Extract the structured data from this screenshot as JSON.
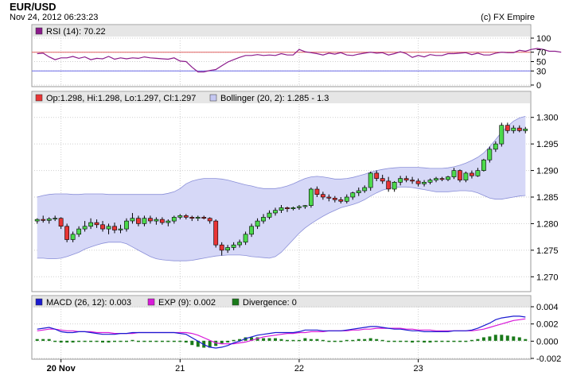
{
  "header": {
    "title": "EUR/USD",
    "date": "Nov 24, 2012 06:23:23",
    "copyright": "(c) FX Empire"
  },
  "colors": {
    "bull": "#4cd94c",
    "bear": "#e83535",
    "band": "#d6d8f7",
    "bandLine": "#8a8fd8",
    "rsi": "#8b1a8b",
    "rsiOver": "#e06060",
    "rsiUnder": "#6a6ae8",
    "macd": "#1a1ad0",
    "exp": "#d91ad9",
    "div": "#1a7a1a",
    "panelHeader": "#e6e6e6",
    "grid": "#cfcfcf",
    "border": "#9a9a9a"
  },
  "chart_data": [
    {
      "type": "line",
      "title": "RSI (14): 70.22",
      "ylim": [
        0,
        100
      ],
      "yticks": [
        "100",
        "70",
        "50",
        "30",
        "0"
      ],
      "levels": {
        "over": 70,
        "under": 30
      },
      "values": [
        67,
        68,
        60,
        54,
        58,
        58,
        61,
        57,
        60,
        54,
        57,
        56,
        61,
        55,
        58,
        56,
        58,
        57,
        60,
        58,
        57,
        56,
        55,
        58,
        51,
        50,
        38,
        28,
        28,
        31,
        33,
        41,
        49,
        54,
        59,
        63,
        63,
        65,
        63,
        64,
        63,
        67,
        64,
        64,
        76,
        71,
        69,
        67,
        64,
        68,
        66,
        69,
        64,
        63,
        66,
        68,
        70,
        68,
        69,
        64,
        67,
        71,
        67,
        59,
        63,
        60,
        65,
        63,
        63,
        67,
        67,
        68,
        69,
        65,
        68,
        64,
        64,
        68,
        70,
        69,
        69,
        74,
        72,
        76,
        78,
        76,
        72,
        72,
        70
      ]
    },
    {
      "type": "candlestick",
      "legend": [
        "Op:1.298, Hi:1.298, Lo:1.297, Cl:1.297",
        "Bollinger (20, 2): 1.285 - 1.3"
      ],
      "ylim": [
        1.2675,
        1.3025
      ],
      "yticks": [
        "1.300",
        "1.295",
        "1.290",
        "1.285",
        "1.280",
        "1.275",
        "1.270"
      ],
      "candles": [
        [
          1.2805,
          1.281,
          1.28,
          1.2808
        ],
        [
          1.2808,
          1.2815,
          1.2802,
          1.2806
        ],
        [
          1.2806,
          1.2812,
          1.28,
          1.2809
        ],
        [
          1.2809,
          1.2815,
          1.2805,
          1.281
        ],
        [
          1.281,
          1.2812,
          1.279,
          1.2795
        ],
        [
          1.2795,
          1.28,
          1.2765,
          1.277
        ],
        [
          1.277,
          1.2785,
          1.2765,
          1.278
        ],
        [
          1.278,
          1.2795,
          1.2775,
          1.279
        ],
        [
          1.279,
          1.2805,
          1.2785,
          1.2795
        ],
        [
          1.2795,
          1.281,
          1.279,
          1.2802
        ],
        [
          1.2802,
          1.2808,
          1.2792,
          1.2798
        ],
        [
          1.2798,
          1.2805,
          1.2785,
          1.279
        ],
        [
          1.279,
          1.28,
          1.278,
          1.2795
        ],
        [
          1.2795,
          1.2802,
          1.2782,
          1.2788
        ],
        [
          1.2788,
          1.2798,
          1.2782,
          1.279
        ],
        [
          1.279,
          1.281,
          1.2785,
          1.2805
        ],
        [
          1.2805,
          1.282,
          1.28,
          1.281
        ],
        [
          1.281,
          1.2815,
          1.2795,
          1.28
        ],
        [
          1.28,
          1.2815,
          1.2795,
          1.281
        ],
        [
          1.281,
          1.2815,
          1.28,
          1.2805
        ],
        [
          1.2805,
          1.2812,
          1.2798,
          1.2808
        ],
        [
          1.2808,
          1.2812,
          1.2798,
          1.2802
        ],
        [
          1.2802,
          1.2808,
          1.2795,
          1.2805
        ],
        [
          1.2805,
          1.2815,
          1.28,
          1.2812
        ],
        [
          1.2812,
          1.2818,
          1.2808,
          1.2815
        ],
        [
          1.2815,
          1.2818,
          1.2808,
          1.2812
        ],
        [
          1.2812,
          1.2815,
          1.2805,
          1.281
        ],
        [
          1.281,
          1.2815,
          1.2805,
          1.2812
        ],
        [
          1.2812,
          1.2815,
          1.2808,
          1.281
        ],
        [
          1.281,
          1.2812,
          1.28,
          1.2805
        ],
        [
          1.2805,
          1.2808,
          1.2755,
          1.276
        ],
        [
          1.276,
          1.2765,
          1.274,
          1.275
        ],
        [
          1.275,
          1.276,
          1.2745,
          1.2755
        ],
        [
          1.2755,
          1.2765,
          1.275,
          1.276
        ],
        [
          1.276,
          1.277,
          1.2755,
          1.2765
        ],
        [
          1.2765,
          1.2785,
          1.276,
          1.278
        ],
        [
          1.278,
          1.28,
          1.2775,
          1.2795
        ],
        [
          1.2795,
          1.281,
          1.279,
          1.2805
        ],
        [
          1.2805,
          1.2818,
          1.28,
          1.2812
        ],
        [
          1.2812,
          1.2825,
          1.2808,
          1.282
        ],
        [
          1.282,
          1.283,
          1.2815,
          1.2825
        ],
        [
          1.2825,
          1.2835,
          1.282,
          1.283
        ],
        [
          1.283,
          1.2832,
          1.2822,
          1.2828
        ],
        [
          1.2828,
          1.2832,
          1.2825,
          1.283
        ],
        [
          1.283,
          1.2835,
          1.2826,
          1.2832
        ],
        [
          1.2832,
          1.2835,
          1.2828,
          1.2834
        ],
        [
          1.2834,
          1.2868,
          1.283,
          1.2865
        ],
        [
          1.2865,
          1.287,
          1.285,
          1.2855
        ],
        [
          1.2855,
          1.286,
          1.2845,
          1.285
        ],
        [
          1.285,
          1.2855,
          1.2842,
          1.2848
        ],
        [
          1.2848,
          1.2852,
          1.284,
          1.2845
        ],
        [
          1.2845,
          1.285,
          1.2838,
          1.2842
        ],
        [
          1.2842,
          1.2855,
          1.2838,
          1.285
        ],
        [
          1.285,
          1.286,
          1.2845,
          1.2858
        ],
        [
          1.2858,
          1.2868,
          1.2852,
          1.2862
        ],
        [
          1.2862,
          1.2872,
          1.2858,
          1.2868
        ],
        [
          1.2868,
          1.2898,
          1.2862,
          1.2895
        ],
        [
          1.2895,
          1.29,
          1.288,
          1.2885
        ],
        [
          1.2885,
          1.2892,
          1.2875,
          1.288
        ],
        [
          1.288,
          1.2888,
          1.286,
          1.2865
        ],
        [
          1.2865,
          1.288,
          1.286,
          1.2878
        ],
        [
          1.2878,
          1.289,
          1.2872,
          1.2885
        ],
        [
          1.2885,
          1.289,
          1.2878,
          1.2882
        ],
        [
          1.2882,
          1.2888,
          1.2875,
          1.288
        ],
        [
          1.288,
          1.2885,
          1.287,
          1.2875
        ],
        [
          1.2875,
          1.2882,
          1.287,
          1.2878
        ],
        [
          1.2878,
          1.2885,
          1.2874,
          1.2882
        ],
        [
          1.2882,
          1.2888,
          1.2878,
          1.2885
        ],
        [
          1.2885,
          1.2888,
          1.288,
          1.2883
        ],
        [
          1.2883,
          1.289,
          1.288,
          1.2888
        ],
        [
          1.2888,
          1.2905,
          1.2884,
          1.29
        ],
        [
          1.29,
          1.2902,
          1.2878,
          1.2882
        ],
        [
          1.2882,
          1.2898,
          1.2878,
          1.2895
        ],
        [
          1.2895,
          1.29,
          1.2885,
          1.289
        ],
        [
          1.289,
          1.2905,
          1.2888,
          1.29
        ],
        [
          1.29,
          1.2922,
          1.2898,
          1.292
        ],
        [
          1.292,
          1.2945,
          1.2915,
          1.294
        ],
        [
          1.294,
          1.2955,
          1.2935,
          1.295
        ],
        [
          1.295,
          1.299,
          1.2945,
          1.2985
        ],
        [
          1.2985,
          1.299,
          1.297,
          1.2975
        ],
        [
          1.2975,
          1.2985,
          1.297,
          1.298
        ],
        [
          1.298,
          1.2985,
          1.2972,
          1.2975
        ],
        [
          1.2975,
          1.2982,
          1.297,
          1.2978
        ]
      ],
      "bollinger_upper": [
        1.285,
        1.2853,
        1.2855,
        1.2856,
        1.2856,
        1.2856,
        1.2855,
        1.2855,
        1.2856,
        1.2856,
        1.2856,
        1.2856,
        1.2855,
        1.2855,
        1.2855,
        1.2855,
        1.2855,
        1.2855,
        1.2855,
        1.2855,
        1.2855,
        1.2855,
        1.2857,
        1.286,
        1.2866,
        1.2875,
        1.288,
        1.2883,
        1.2885,
        1.2885,
        1.2885,
        1.2884,
        1.2882,
        1.2879,
        1.2876,
        1.2873,
        1.2871,
        1.2868,
        1.2866,
        1.2866,
        1.2866,
        1.2868,
        1.2871,
        1.2875,
        1.288,
        1.2885,
        1.2888,
        1.2889,
        1.2888,
        1.2886,
        1.2884,
        1.2884,
        1.2885,
        1.2887,
        1.289,
        1.2893,
        1.2897,
        1.29,
        1.2902,
        1.2904,
        1.2905,
        1.2906,
        1.2906,
        1.2906,
        1.2906,
        1.2905,
        1.2904,
        1.2904,
        1.2904,
        1.2905,
        1.2907,
        1.291,
        1.2914,
        1.2919,
        1.2925,
        1.2933,
        1.2945,
        1.2958,
        1.2972,
        1.2983,
        1.2993,
        1.2999,
        1.3002
      ],
      "bollinger_lower": [
        1.2735,
        1.2735,
        1.2734,
        1.2734,
        1.2735,
        1.2738,
        1.2742,
        1.2746,
        1.2752,
        1.2756,
        1.276,
        1.2763,
        1.2765,
        1.2765,
        1.2765,
        1.2762,
        1.2756,
        1.275,
        1.2744,
        1.2738,
        1.2734,
        1.2732,
        1.2731,
        1.273,
        1.273,
        1.273,
        1.2731,
        1.2733,
        1.2735,
        1.2737,
        1.2739,
        1.274,
        1.2741,
        1.2741,
        1.2741,
        1.274,
        1.2738,
        1.2737,
        1.2736,
        1.2735,
        1.2738,
        1.2746,
        1.2758,
        1.277,
        1.2782,
        1.2792,
        1.28,
        1.2807,
        1.2814,
        1.282,
        1.2825,
        1.283,
        1.2833,
        1.2836,
        1.284,
        1.2845,
        1.2852,
        1.2858,
        1.2863,
        1.2866,
        1.2868,
        1.2869,
        1.2869,
        1.2868,
        1.2866,
        1.2864,
        1.2862,
        1.286,
        1.286,
        1.286,
        1.2861,
        1.2862,
        1.2862,
        1.2861,
        1.2858,
        1.2853,
        1.2848,
        1.2846,
        1.2846,
        1.2848,
        1.285,
        1.2852,
        1.2853
      ]
    },
    {
      "type": "line",
      "legend": [
        "MACD (26, 12): 0.003",
        "EXP (9): 0.002",
        "Divergence: 0"
      ],
      "ylim": [
        -0.002,
        0.004
      ],
      "yticks": [
        "0.004",
        "0.002",
        "0.000",
        "-0.002"
      ],
      "macd": [
        0.0014,
        0.0015,
        0.0016,
        0.0014,
        0.0011,
        0.001,
        0.001,
        0.0011,
        0.0011,
        0.001,
        0.0009,
        0.0008,
        0.0008,
        0.0008,
        0.0009,
        0.0009,
        0.001,
        0.001,
        0.001,
        0.001,
        0.001,
        0.001,
        0.001,
        0.001,
        0.0009,
        0.0008,
        0.0004,
        0.0,
        -0.0004,
        -0.0007,
        -0.0008,
        -0.0007,
        -0.0005,
        -0.0002,
        0.0,
        0.0003,
        0.0005,
        0.0007,
        0.0008,
        0.0009,
        0.001,
        0.001,
        0.001,
        0.001,
        0.0011,
        0.0013,
        0.0013,
        0.0013,
        0.0012,
        0.0012,
        0.0012,
        0.0012,
        0.0013,
        0.0014,
        0.0015,
        0.0016,
        0.0017,
        0.0017,
        0.0016,
        0.0015,
        0.0014,
        0.0014,
        0.0013,
        0.0012,
        0.0012,
        0.0011,
        0.0011,
        0.0011,
        0.0011,
        0.0011,
        0.0012,
        0.0012,
        0.0012,
        0.0013,
        0.0015,
        0.0018,
        0.0021,
        0.0025,
        0.0027,
        0.0028,
        0.0029,
        0.0029,
        0.0028
      ],
      "exp": [
        0.0012,
        0.0013,
        0.0014,
        0.0014,
        0.0013,
        0.0012,
        0.0012,
        0.0011,
        0.0011,
        0.0011,
        0.001,
        0.001,
        0.001,
        0.0009,
        0.0009,
        0.0009,
        0.0009,
        0.001,
        0.001,
        0.001,
        0.001,
        0.001,
        0.001,
        0.001,
        0.001,
        0.001,
        0.0009,
        0.0007,
        0.0004,
        0.0001,
        -0.0002,
        -0.0003,
        -0.0003,
        -0.0003,
        -0.0002,
        -0.0001,
        0.0001,
        0.0003,
        0.0005,
        0.0006,
        0.0007,
        0.0008,
        0.0009,
        0.0009,
        0.001,
        0.001,
        0.0011,
        0.0011,
        0.0011,
        0.0012,
        0.0012,
        0.0012,
        0.0012,
        0.0013,
        0.0013,
        0.0014,
        0.0014,
        0.0015,
        0.0015,
        0.0015,
        0.0015,
        0.0015,
        0.0014,
        0.0014,
        0.0013,
        0.0013,
        0.0013,
        0.0012,
        0.0012,
        0.0012,
        0.0012,
        0.0012,
        0.0012,
        0.0012,
        0.0013,
        0.0014,
        0.0016,
        0.0018,
        0.002,
        0.0022,
        0.0024,
        0.0025,
        0.0026
      ]
    }
  ],
  "xaxis": {
    "labels": [
      {
        "text": "20 Nov",
        "index": 4,
        "bold": true
      },
      {
        "text": "21",
        "index": 24
      },
      {
        "text": "22",
        "index": 44
      },
      {
        "text": "23",
        "index": 64
      }
    ]
  }
}
